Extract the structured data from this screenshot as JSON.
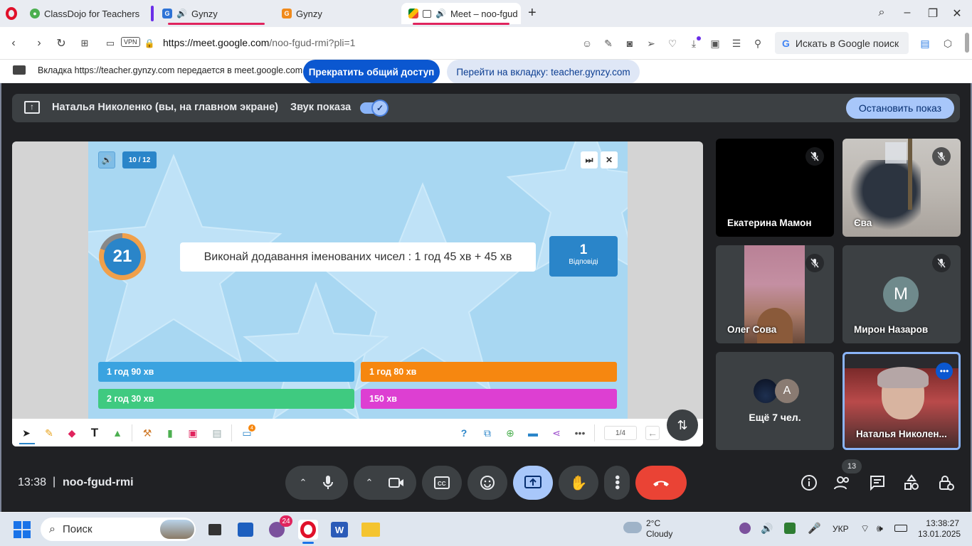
{
  "browser": {
    "tabs": [
      {
        "title": "ClassDojo for Teachers",
        "favicon": "classdojo-icon"
      },
      {
        "title": "Gynzy",
        "favicon": "gynzy-icon",
        "audio": true
      },
      {
        "title": "Gynzy",
        "favicon": "gynzy-icon"
      },
      {
        "title": "Meet – noo-fgud-r",
        "favicon": "meet-icon",
        "audio": true
      }
    ],
    "new_tab": "+",
    "url_host": "https://meet.google.com",
    "url_path": "/noo-fgud-rmi?pli=1",
    "vpn_label": "VPN",
    "search_placeholder": "Искать в Google поиск"
  },
  "share_notice": {
    "text": "Вкладка https://teacher.gynzy.com передается в meet.google.com",
    "stop_button": "Прекратить общий доступ",
    "goto_button": "Перейти на вкладку: teacher.gynzy.com"
  },
  "presentation_bar": {
    "presenter": "Наталья Николенко (вы, на главном экране)",
    "sound_label": "Звук показа",
    "sound_on": true,
    "stop_button": "Остановить показ"
  },
  "slide": {
    "progress": "10 / 12",
    "timer": "21",
    "question": "Виконай додавання іменованих чисел : 1 год 45 хв + 45 хв",
    "answers_count": "1",
    "answers_label": "Відповіді",
    "options": [
      {
        "text": "1 год 90 хв",
        "color": "#3aa3e0"
      },
      {
        "text": "1 год 80 хв",
        "color": "#f68710"
      },
      {
        "text": "2 год 30 хв",
        "color": "#3fca80"
      },
      {
        "text": "150 хв",
        "color": "#dd3fd2"
      }
    ],
    "page": "1/4",
    "badge_count": "4"
  },
  "participants": [
    {
      "name": "Екатерина Мамон",
      "muted": true
    },
    {
      "name": "Єва",
      "muted": true
    },
    {
      "name": "Олег Сова",
      "muted": true
    },
    {
      "name": "Мирон Назаров",
      "muted": true,
      "initial": "M"
    },
    {
      "name": "Ещё 7 чел.",
      "initial": "A"
    },
    {
      "name": "Наталья Николен..."
    }
  ],
  "meeting": {
    "time": "13:38",
    "code": "noo-fgud-rmi",
    "people_count": "13"
  },
  "taskbar": {
    "search_label": "Поиск",
    "viber_badge": "24",
    "temperature": "2°C",
    "weather": "Cloudy",
    "language": "УКР",
    "time": "13:38:27",
    "date": "13.01.2025"
  },
  "colors": {
    "meet_bg": "#202124",
    "accent": "#0b57d0",
    "end_call": "#ea4335"
  }
}
